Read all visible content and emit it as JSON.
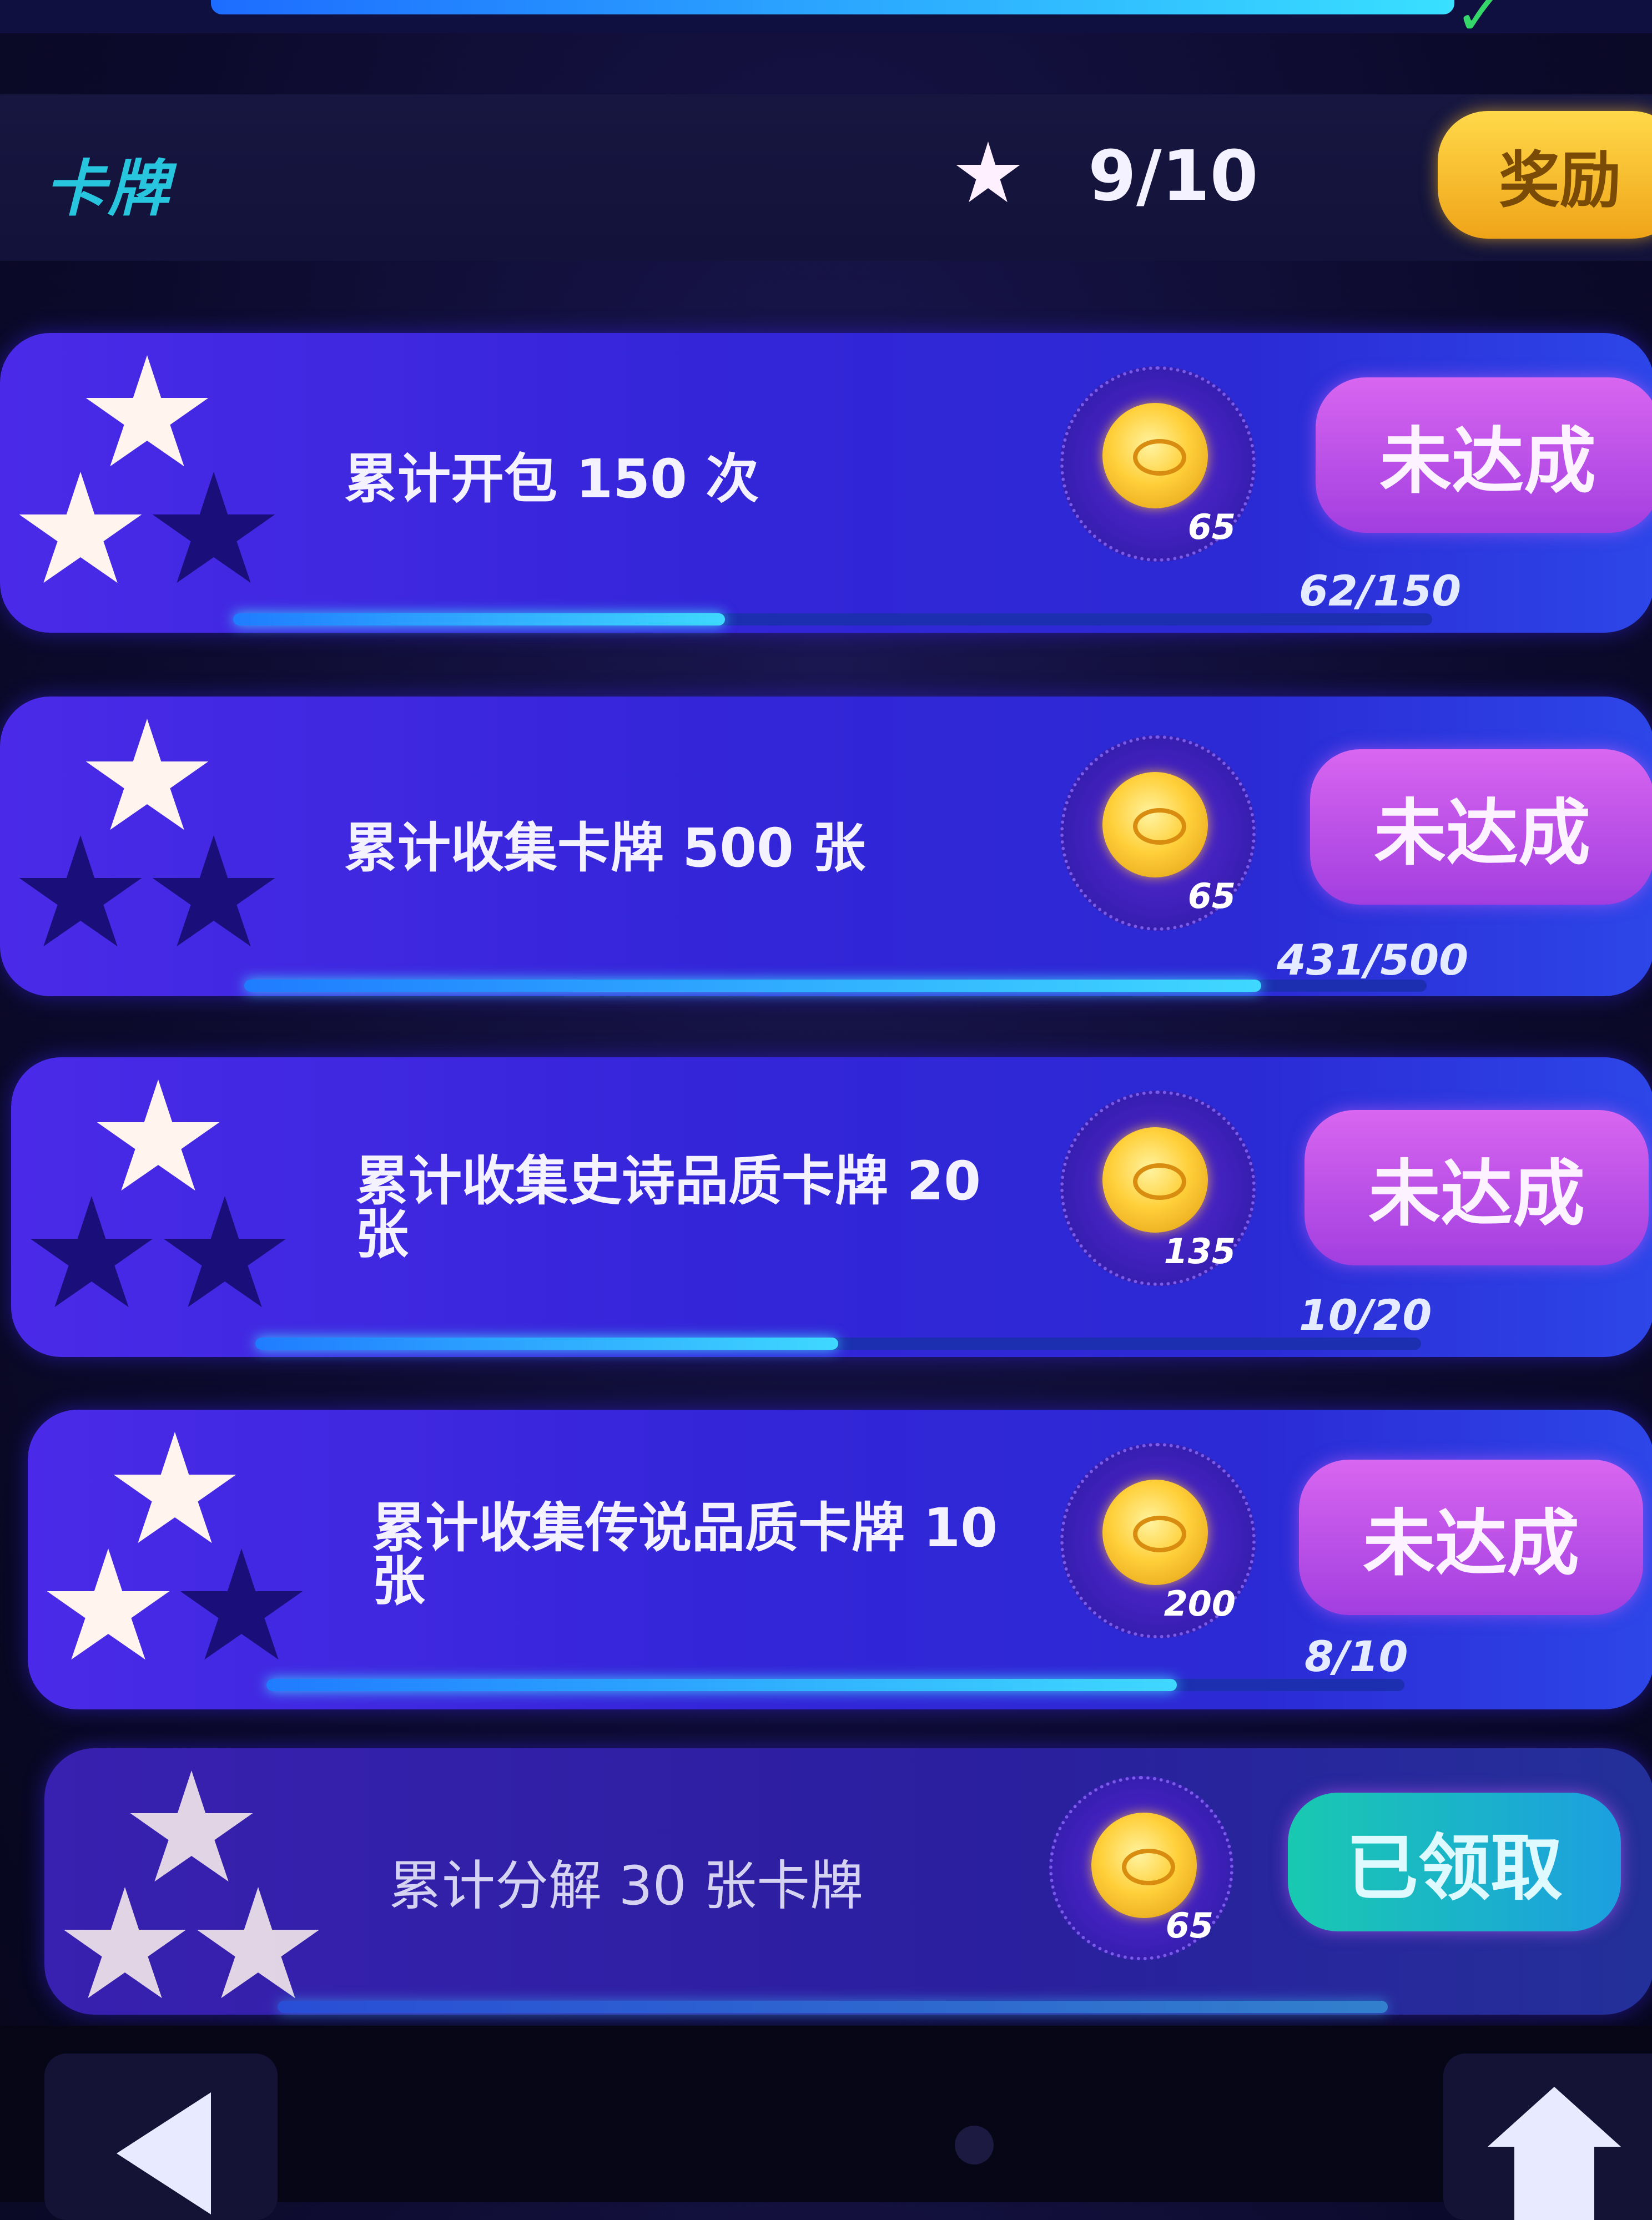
{
  "section": {
    "title": "卡牌",
    "star_progress": "9/10",
    "reward_label": "奖励"
  },
  "tasks": [
    {
      "text": "累计开包 150 次",
      "reward": "65",
      "status": "未达成",
      "progress_text": "62/150",
      "progress": 0.41,
      "stars_lit": 2
    },
    {
      "text": "累计收集卡牌 500 张",
      "reward": "65",
      "status": "未达成",
      "progress_text": "431/500",
      "progress": 0.86,
      "stars_lit": 1
    },
    {
      "text": "累计收集史诗品质卡牌 20 张",
      "reward": "135",
      "status": "未达成",
      "progress_text": "10/20",
      "progress": 0.5,
      "stars_lit": 1
    },
    {
      "text": "累计收集传说品质卡牌 10 张",
      "reward": "200",
      "status": "未达成",
      "progress_text": "8/10",
      "progress": 0.8,
      "stars_lit": 2
    },
    {
      "text": "累计分解 30 张卡牌",
      "reward": "65",
      "status": "已领取",
      "progress_text": "",
      "progress": 1.0,
      "stars_lit": 3
    }
  ],
  "icons": {
    "star": "star-icon",
    "coin": "coin-icon",
    "back": "back-arrow-icon",
    "home": "home-icon",
    "check": "check-icon"
  },
  "colors": {
    "accent_gold": "#ffd94a",
    "status_pending": "#c451e8",
    "status_claimed": "#19c9b0",
    "progress": "#3fd8ff"
  }
}
